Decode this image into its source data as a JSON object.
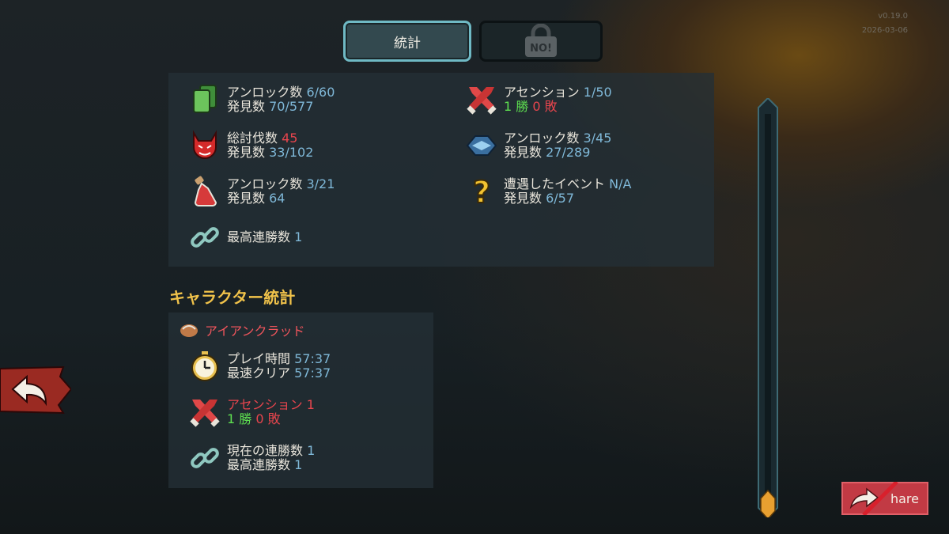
{
  "version": {
    "line1": "v0.19.0",
    "line2": "2026-03-06"
  },
  "tabs": {
    "stats_label": "統計",
    "locked_label": "NO!"
  },
  "general_stats": {
    "cards": {
      "unlock_label": "アンロック数",
      "unlock_value": "6/60",
      "seen_label": "発見数",
      "seen_value": "70/577"
    },
    "monsters": {
      "kills_label": "総討伐数",
      "kills_value": "45",
      "seen_label": "発見数",
      "seen_value": "33/102"
    },
    "potions": {
      "unlock_label": "アンロック数",
      "unlock_value": "3/21",
      "seen_label": "発見数",
      "seen_value": "64"
    },
    "streak": {
      "label": "最高連勝数",
      "value": "1"
    },
    "ascension": {
      "label": "アセンション",
      "value": "1/50",
      "wins": "1 勝",
      "losses": "0 敗"
    },
    "relics": {
      "unlock_label": "アンロック数",
      "unlock_value": "3/45",
      "seen_label": "発見数",
      "seen_value": "27/289"
    },
    "events": {
      "label": "遭遇したイベント",
      "value": "N/A",
      "seen_label": "発見数",
      "seen_value": "6/57"
    }
  },
  "character_stats": {
    "title": "キャラクター統計",
    "character": {
      "name": "アイアンクラッド",
      "playtime_label": "プレイ時間",
      "playtime_value": "57:37",
      "fastest_label": "最速クリア",
      "fastest_value": "57:37",
      "ascension_label": "アセンション",
      "ascension_value": "1",
      "wins": "1 勝",
      "losses": "0 敗",
      "current_streak_label": "現在の連勝数",
      "current_streak_value": "1",
      "best_streak_label": "最高連勝数",
      "best_streak_value": "1"
    }
  },
  "buttons": {
    "share_label": "hare"
  }
}
